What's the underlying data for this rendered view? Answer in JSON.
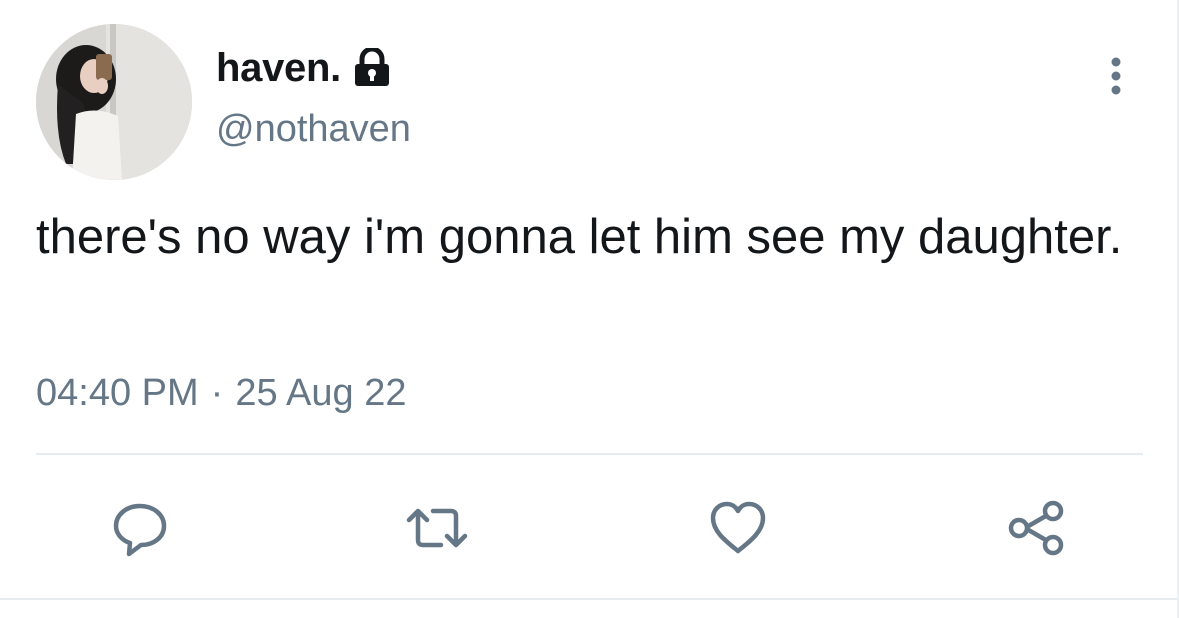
{
  "user": {
    "display_name": "haven.",
    "handle": "@nothaven",
    "protected_icon": "lock-icon",
    "avatar_icon": "profile-photo"
  },
  "tweet": {
    "text": "there's no way i'm gonna let him see my daughter.",
    "time": "04:40 PM",
    "separator": "·",
    "date": "25 Aug 22"
  },
  "actions": [
    {
      "name": "reply",
      "icon": "reply-icon"
    },
    {
      "name": "retweet",
      "icon": "retweet-icon"
    },
    {
      "name": "like",
      "icon": "heart-icon"
    },
    {
      "name": "share",
      "icon": "share-icon"
    }
  ],
  "colors": {
    "text_primary": "#14171a",
    "text_secondary": "#657786",
    "icon": "#657786",
    "divider": "#e6ecf0",
    "background": "#ffffff"
  }
}
